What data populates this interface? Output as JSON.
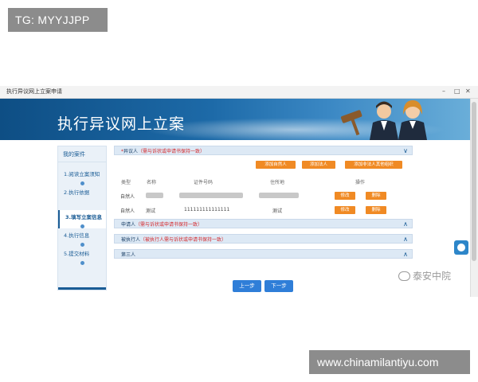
{
  "watermarks": {
    "top": "TG: MYYJJPP",
    "bottom": "www.chinamilantiyu.com"
  },
  "window": {
    "title": "执行异议网上立案申请",
    "minimize": "–",
    "restore": "□",
    "close": "✕"
  },
  "banner": {
    "title": "执行异议网上立案"
  },
  "sidebar": {
    "header": "我的案件",
    "steps": [
      {
        "label": "1.阅读立案须知"
      },
      {
        "label": "2.执行依据"
      },
      {
        "label": "3.填写立案信息"
      },
      {
        "label": "4.执行信息"
      },
      {
        "label": "5.提交材料"
      }
    ]
  },
  "sections": {
    "objector": {
      "label": "异议人",
      "required_mark": "*",
      "note": "（需与诉状或申请书保持一致）",
      "chevron": "∨"
    },
    "applicant": {
      "label": "申请人",
      "note": "（需与诉状或申请书保持一致）",
      "chevron": "∧"
    },
    "executed": {
      "label": "被执行人",
      "note": "（被执行人需与诉状或申请书保持一致）",
      "chevron": "∧"
    },
    "third": {
      "label": "第三人",
      "chevron": "∧"
    }
  },
  "add_buttons": [
    "添加自然人",
    "添加法人",
    "添加非法人其他组织"
  ],
  "table": {
    "headers": [
      "类型",
      "名称",
      "证件号码",
      "住所地",
      "操作"
    ],
    "rows": [
      {
        "type": "自然人",
        "name": "",
        "id_number": "",
        "address": "",
        "edit": "修改",
        "delete": "删除"
      },
      {
        "type": "自然人",
        "name": "测试",
        "id_number": "111111111111111",
        "address": "测试",
        "edit": "修改",
        "delete": "删除"
      }
    ]
  },
  "nav": {
    "prev": "上一步",
    "next": "下一步"
  },
  "footer_brand": "泰安中院",
  "colors": {
    "accent": "#f08a24",
    "primary": "#1a5c95",
    "button_blue": "#2f7ed8",
    "required": "#d4282c"
  }
}
